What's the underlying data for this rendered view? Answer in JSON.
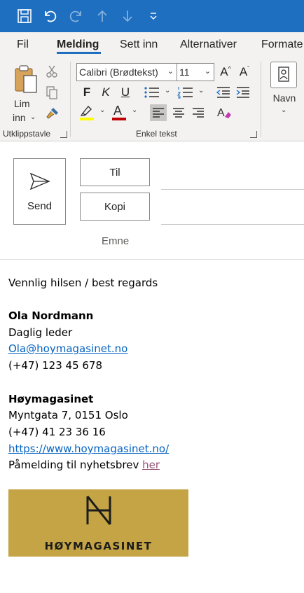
{
  "ribbon": {
    "tabs": [
      "Fil",
      "Melding",
      "Sett inn",
      "Alternativer",
      "Formate"
    ],
    "active_tab": "Melding",
    "clipboard": {
      "paste_label_line1": "Lim",
      "paste_label_line2": "inn",
      "group_label": "Utklippstavle"
    },
    "basic_text": {
      "font_name": "Calibri (Brødtekst)",
      "font_size": "11",
      "grow_font": "A",
      "shrink_font": "A",
      "bold": "F",
      "italic": "K",
      "underline": "U",
      "font_color_letter": "A",
      "highlight_color": "#ffff00",
      "font_color": "#c00000",
      "group_label": "Enkel tekst"
    },
    "names": {
      "label": "Navn"
    }
  },
  "compose": {
    "send_label": "Send",
    "to_label": "Til",
    "cc_label": "Kopi",
    "subject_label": "Emne"
  },
  "signature": {
    "greeting": "Vennlig hilsen / best regards",
    "name": "Ola Nordmann",
    "title": "Daglig leder",
    "email": "Ola@hoymagasinet.no",
    "phone": "(+47) 123 45 678",
    "company": "Høymagasinet",
    "address": "Myntgata 7, 0151 Oslo",
    "company_phone": "(+47) 41 23 36 16",
    "website": "https://www.hoymagasinet.no/",
    "newsletter_text": "Påmelding til nyhetsbrev ",
    "newsletter_link": "her",
    "logo_text": "HØYMAGASINET",
    "logo_color": "#c4a444"
  },
  "colors": {
    "titlebar": "#1e6fc0",
    "link": "#0563c1"
  }
}
